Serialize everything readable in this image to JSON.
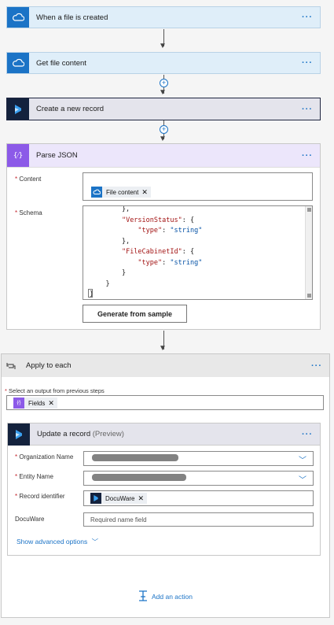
{
  "steps": [
    {
      "title": "When a file is created",
      "icon": "onedrive-cloud-icon"
    },
    {
      "title": "Get file content",
      "icon": "onedrive-cloud-icon"
    },
    {
      "title": "Create a new record",
      "icon": "dynamics-icon"
    }
  ],
  "more_label": "···",
  "parse": {
    "title": "Parse JSON",
    "content_label": "Content",
    "content_token": "File content",
    "schema_label": "Schema",
    "schema_lines": [
      "        },",
      "        \"VersionStatus\": {",
      "            \"type\": \"string\"",
      "        },",
      "        \"FileCabinetId\": {",
      "            \"type\": \"string\"",
      "        }",
      "    }",
      "}"
    ],
    "generate_label": "Generate from sample"
  },
  "apply": {
    "title": "Apply to each",
    "select_label": "Select an output from previous steps",
    "token": "Fields"
  },
  "update": {
    "title": "Update a record",
    "preview": "(Preview)",
    "org_label": "Organization Name",
    "entity_label": "Entity Name",
    "record_label": "Record identifier",
    "record_token": "DocuWare",
    "docuware_label": "DocuWare",
    "docuware_placeholder": "Required name field",
    "advanced": "Show advanced options"
  },
  "add_action": "Add an action",
  "colors": {
    "accent": "#1b73c6",
    "dynamics": "#14223d",
    "parse": "#8c5ae8",
    "required": "#c4262e"
  }
}
